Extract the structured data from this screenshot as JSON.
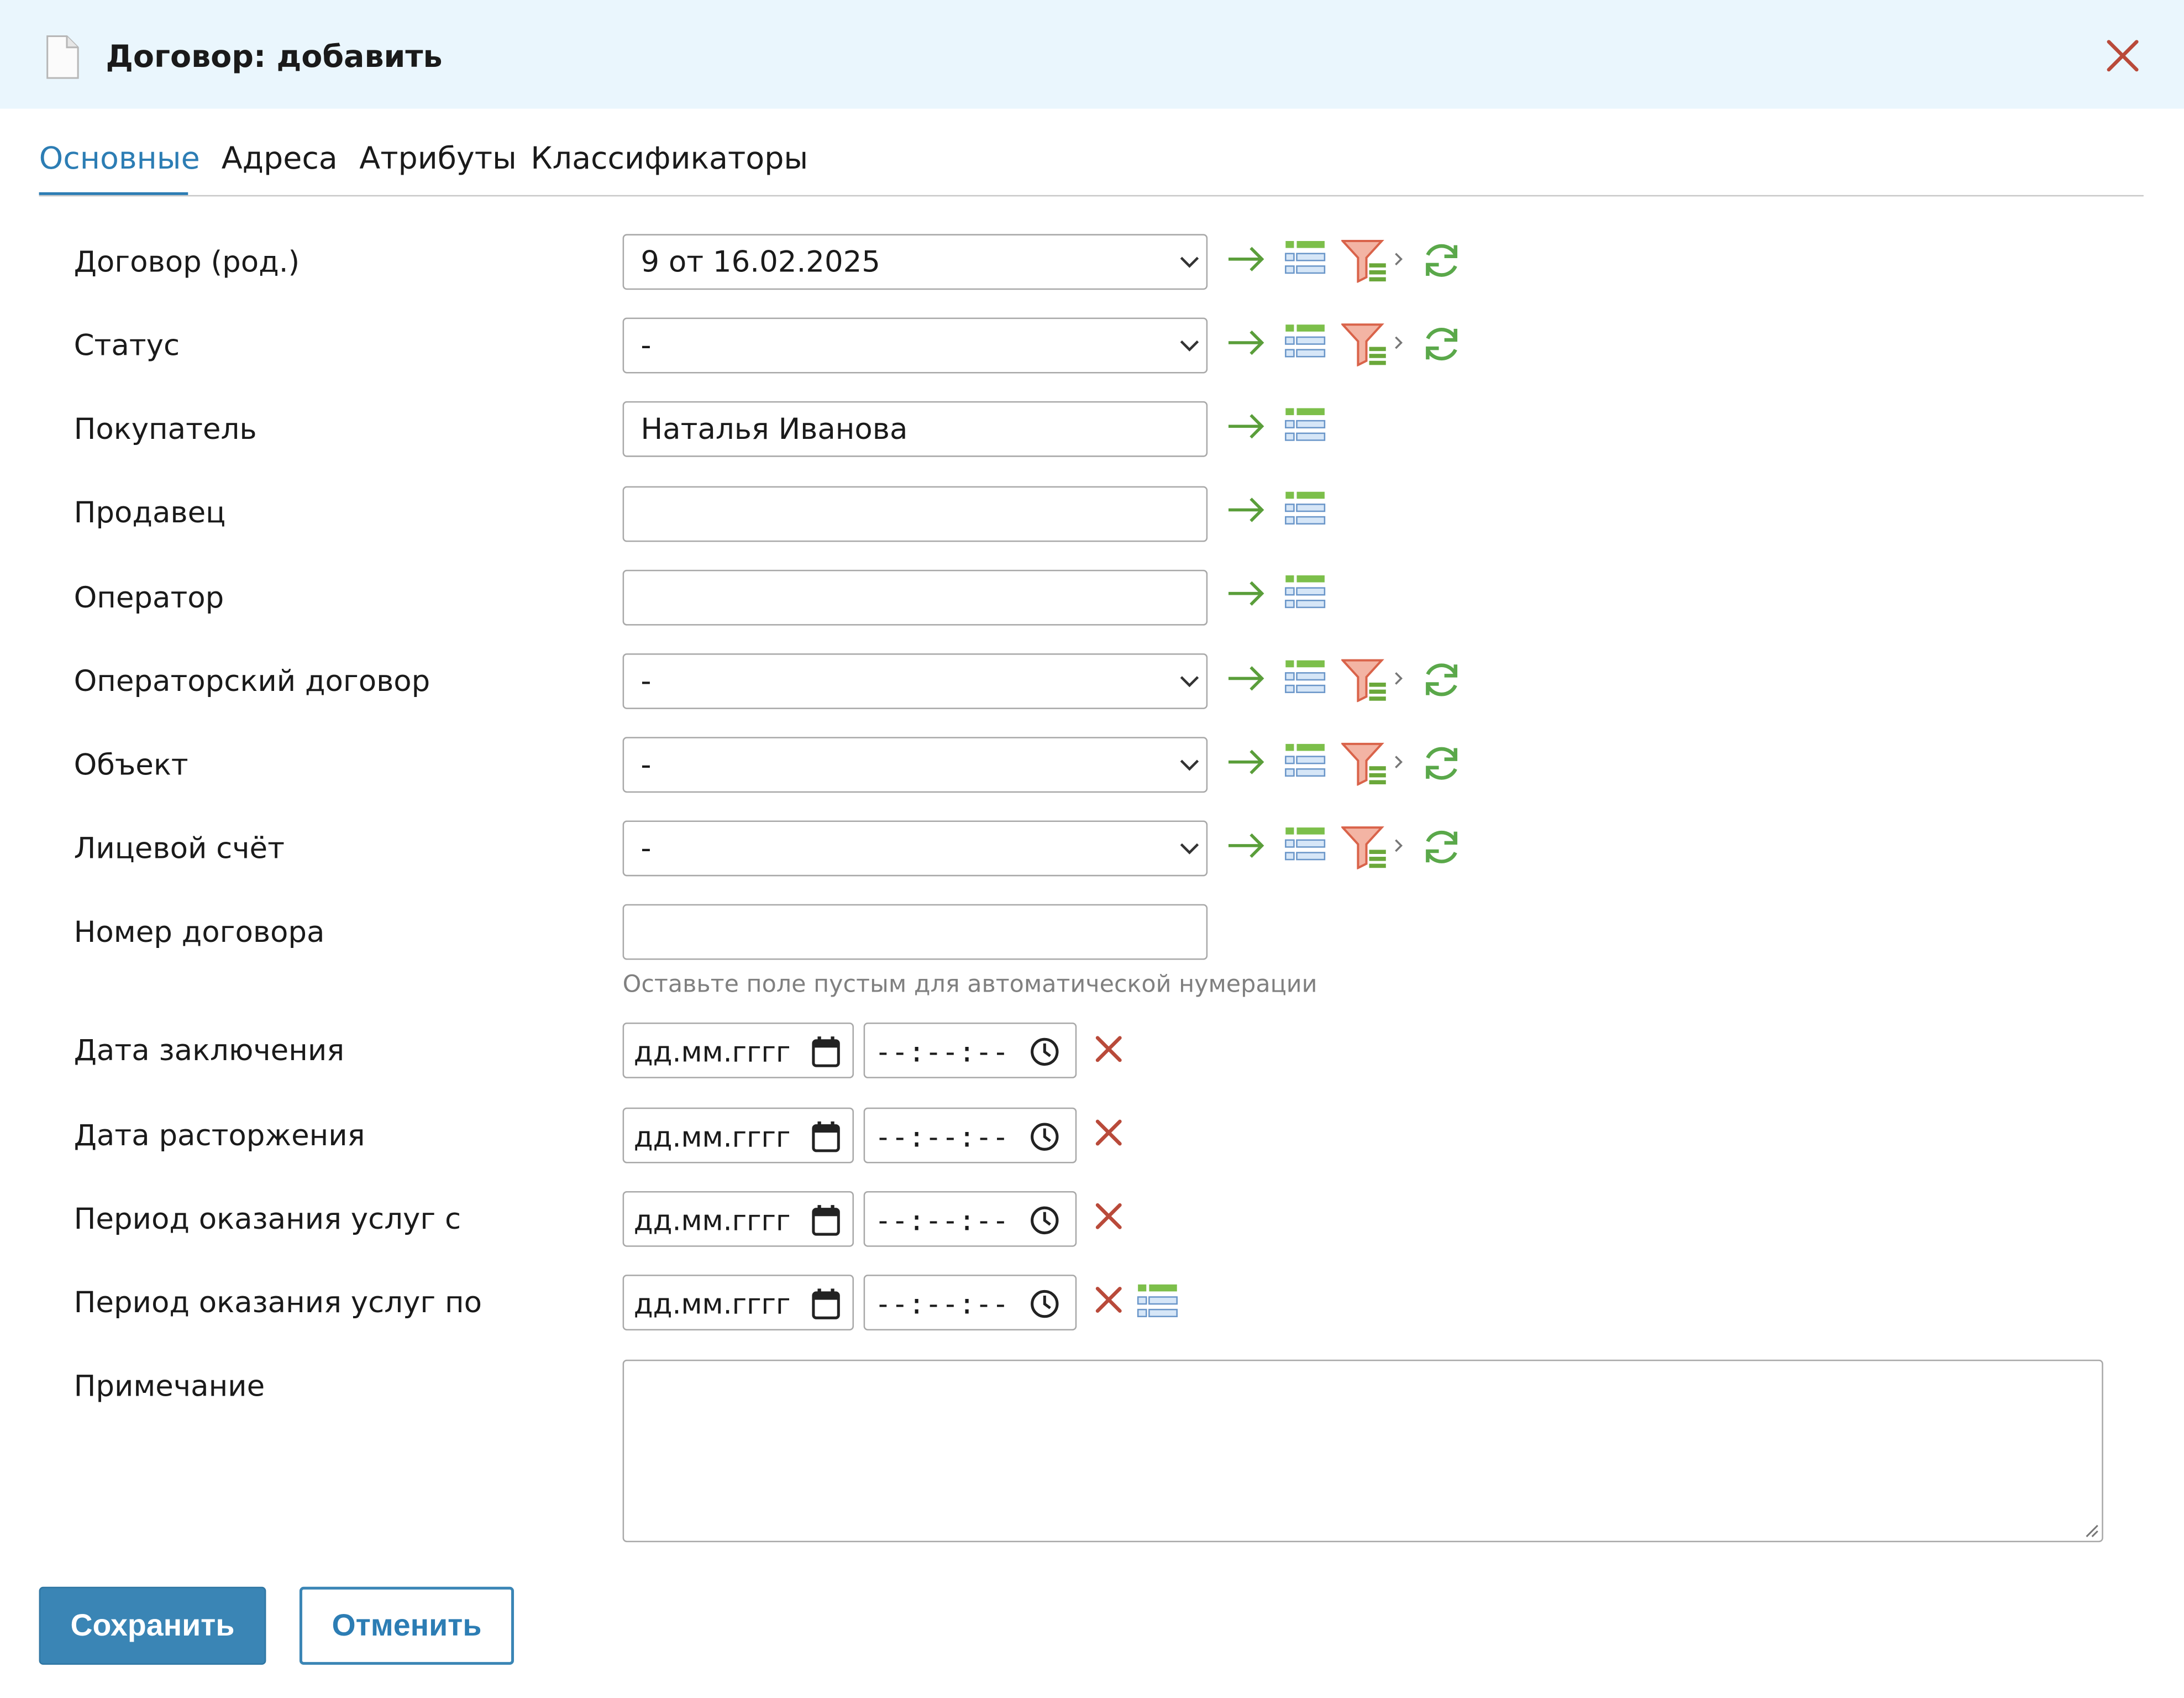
{
  "dialog": {
    "title": "Договор: добавить",
    "icon": "document-icon",
    "close_icon": "close-icon"
  },
  "tabs": [
    {
      "label": "Основные",
      "active": true
    },
    {
      "label": "Адреса",
      "active": false
    },
    {
      "label": "Атрибуты",
      "active": false
    },
    {
      "label": "Классификаторы",
      "active": false
    }
  ],
  "form": {
    "contract_parent": {
      "label": "Договор (род.)",
      "value": "9 от 16.02.2025"
    },
    "status": {
      "label": "Статус",
      "value": "-"
    },
    "buyer": {
      "label": "Покупатель",
      "value": "Наталья Иванова"
    },
    "seller": {
      "label": "Продавец",
      "value": ""
    },
    "operator": {
      "label": "Оператор",
      "value": ""
    },
    "operator_contract": {
      "label": "Операторский договор",
      "value": "-"
    },
    "object": {
      "label": "Объект",
      "value": "-"
    },
    "account": {
      "label": "Лицевой счёт",
      "value": "-"
    },
    "contract_number": {
      "label": "Номер договора",
      "value": "",
      "hint": "Оставьте поле пустым для автоматической нумерации"
    },
    "date_signed": {
      "label": "Дата заключения",
      "date_placeholder": "дд.мм.гггг",
      "time_placeholder": "--:--:--"
    },
    "date_terminated": {
      "label": "Дата расторжения",
      "date_placeholder": "дд.мм.гггг",
      "time_placeholder": "--:--:--"
    },
    "period_from": {
      "label": "Период оказания услуг с",
      "date_placeholder": "дд.мм.гггг",
      "time_placeholder": "--:--:--"
    },
    "period_to": {
      "label": "Период оказания услуг по",
      "date_placeholder": "дд.мм.гггг",
      "time_placeholder": "--:--:--"
    },
    "note": {
      "label": "Примечание",
      "value": ""
    }
  },
  "buttons": {
    "save": "Сохранить",
    "cancel": "Отменить"
  },
  "colors": {
    "header_bg": "#eaf6fd",
    "accent": "#2c7db4",
    "save_bg": "#3a85b5",
    "arrow_green": "#5a9e3a",
    "filter_red": "#d9634a",
    "clear_red": "#b94a3a"
  },
  "icons": {
    "select_row": [
      "arrow-right-icon",
      "list-icon",
      "filter-icon",
      "chevron-right-icon",
      "refresh-icon"
    ],
    "text_row": [
      "arrow-right-icon",
      "list-icon"
    ],
    "date_row": [
      "calendar-icon",
      "clock-icon",
      "clear-icon"
    ]
  }
}
